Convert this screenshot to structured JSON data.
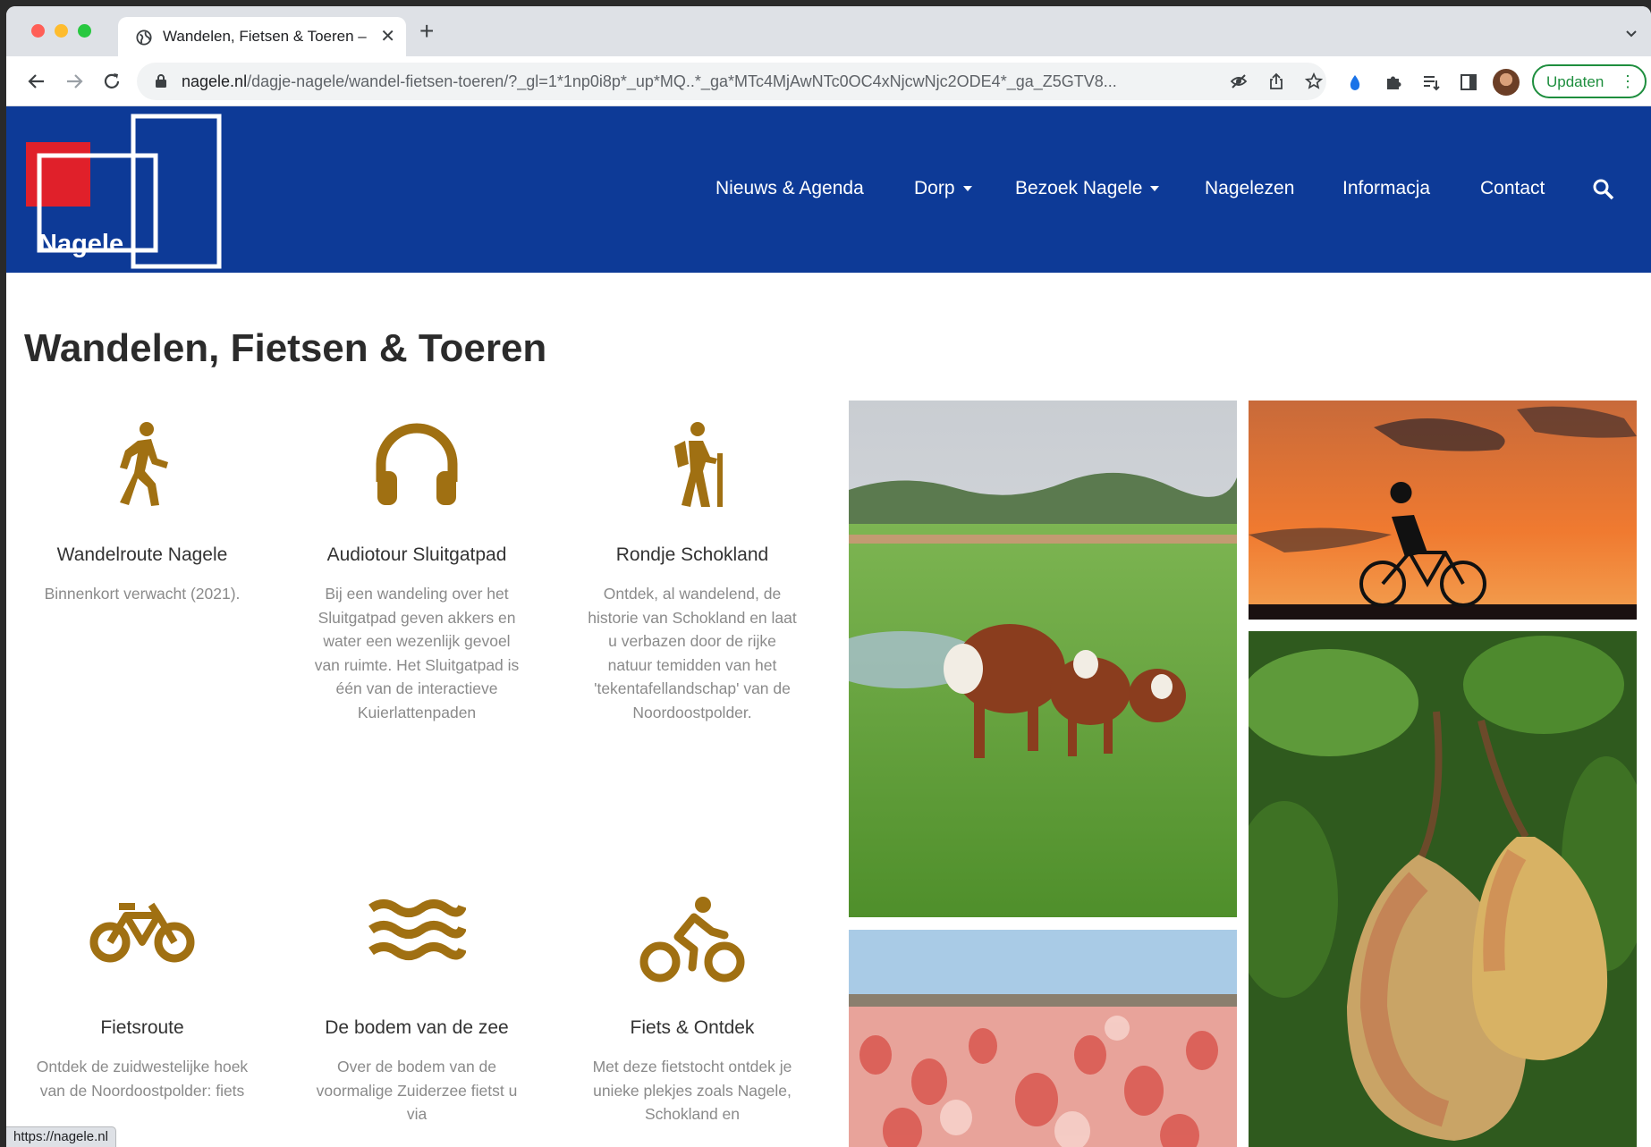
{
  "browser": {
    "tab_title": "Wandelen, Fietsen & Toeren – N",
    "url_host": "nagele.nl",
    "url_path": "/dagje-nagele/wandel-fietsen-toeren/?_gl=1*1np0i8p*_up*MQ..*_ga*MTc4MjAwNTc0OC4xNjcwNjc2ODE4*_ga_Z5GTV8...",
    "update_label": "Updaten",
    "status_url": "https://nagele.nl"
  },
  "site": {
    "logo_text": "Nagele",
    "brand_blue": "#0d3a97",
    "brand_red": "#e0202a",
    "icon_color": "#a07012",
    "nav": [
      {
        "label": "Nieuws & Agenda"
      },
      {
        "label": "Dorp"
      },
      {
        "label": "Bezoek Nagele"
      },
      {
        "label": "Nagelezen"
      },
      {
        "label": "Informacja"
      },
      {
        "label": "Contact"
      }
    ]
  },
  "page": {
    "title": "Wandelen, Fietsen & Toeren",
    "cards": [
      {
        "icon": "walking-icon",
        "title": "Wandelroute Nagele",
        "text": "Binnenkort verwacht (2021)."
      },
      {
        "icon": "headphones-icon",
        "title": "Audiotour Sluitgatpad",
        "text": "Bij een wandeling over het Sluitgatpad geven akkers en water een wezenlijk gevoel van ruimte. Het Sluitgatpad is één van de interactieve Kuierlattenpaden"
      },
      {
        "icon": "hiking-icon",
        "title": "Rondje Schokland",
        "text": "Ontdek, al wandelend, de historie van Schokland en laat u verbazen door de rijke natuur temidden van het 'tekentafellandschap' van de Noordoostpolder."
      },
      {
        "icon": "bicycle-icon",
        "title": "Fietsroute",
        "text": "Ontdek de zuidwestelijke hoek van de Noordoostpolder: fiets"
      },
      {
        "icon": "water-icon",
        "title": "De bodem van de zee",
        "text": "Over de bodem van de voormalige Zuiderzee fietst u via"
      },
      {
        "icon": "cyclist-icon",
        "title": "Fiets & Ontdek",
        "text": "Met deze fietstocht ontdek je unieke plekjes zoals Nagele, Schokland en"
      }
    ]
  }
}
